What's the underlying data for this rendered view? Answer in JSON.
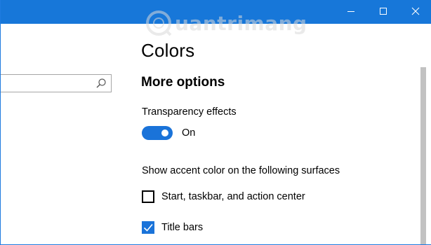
{
  "window": {
    "accent_color": "#1777d9",
    "controls": {
      "minimize_icon": "minimize-icon",
      "maximize_icon": "maximize-icon",
      "close_icon": "close-icon"
    }
  },
  "watermark": {
    "text": "uantrimang"
  },
  "search": {
    "value": "",
    "placeholder": "",
    "icon": "search-icon"
  },
  "page": {
    "title": "Colors",
    "section_title": "More options"
  },
  "transparency": {
    "label": "Transparency effects",
    "state_label": "On",
    "enabled": true
  },
  "accent_surfaces": {
    "label": "Show accent color on the following surfaces",
    "options": [
      {
        "label": "Start, taskbar, and action center",
        "checked": false
      },
      {
        "label": "Title bars",
        "checked": true
      }
    ]
  },
  "colors": {
    "toggle_on": "#1a73d9",
    "checkbox_checked": "#1a73d9"
  }
}
